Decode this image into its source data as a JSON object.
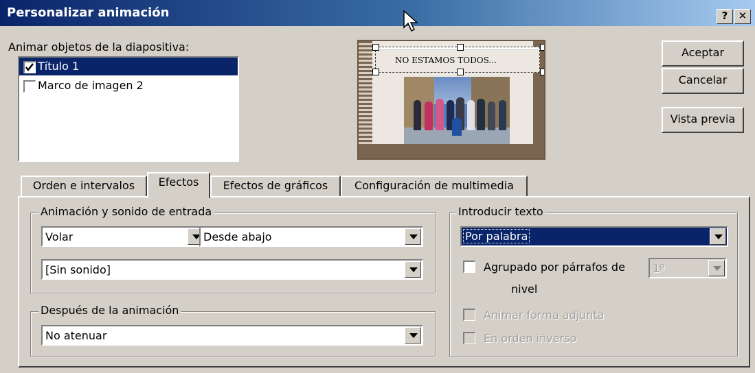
{
  "window": {
    "title": "Personalizar animación",
    "help_label": "?",
    "close_label": "✕"
  },
  "objects": {
    "label": "Animar objetos de la diapositiva:",
    "items": [
      {
        "label": "Título 1",
        "checked": true,
        "selected": true
      },
      {
        "label": "Marco de imagen 2",
        "checked": false,
        "selected": false
      }
    ]
  },
  "preview": {
    "slide_title": "NO ESTAMOS TODOS..."
  },
  "buttons": {
    "ok": "Aceptar",
    "cancel": "Cancelar",
    "preview": "Vista previa"
  },
  "tabs": [
    {
      "label": "Orden e intervalos",
      "active": false
    },
    {
      "label": "Efectos",
      "active": true
    },
    {
      "label": "Efectos de gráficos",
      "active": false
    },
    {
      "label": "Configuración de multimedia",
      "active": false
    }
  ],
  "entry": {
    "legend": "Animación y sonido de entrada",
    "effect": "Volar",
    "direction": "Desde abajo",
    "sound": "[Sin sonido]"
  },
  "after": {
    "legend": "Después de la animación",
    "value": "No atenuar"
  },
  "text_intro": {
    "legend": "Introducir texto",
    "value": "Por palabra",
    "group_label": "Agrupado por párrafos de",
    "group_label_2": "nivel",
    "level_value": "1º",
    "animate_shape": "Animar forma adjunta",
    "reverse_order": "En orden inverso"
  },
  "colors": {
    "title_bar": "#0a246a",
    "selection": "#0a246a",
    "face": "#d4d0c8"
  }
}
